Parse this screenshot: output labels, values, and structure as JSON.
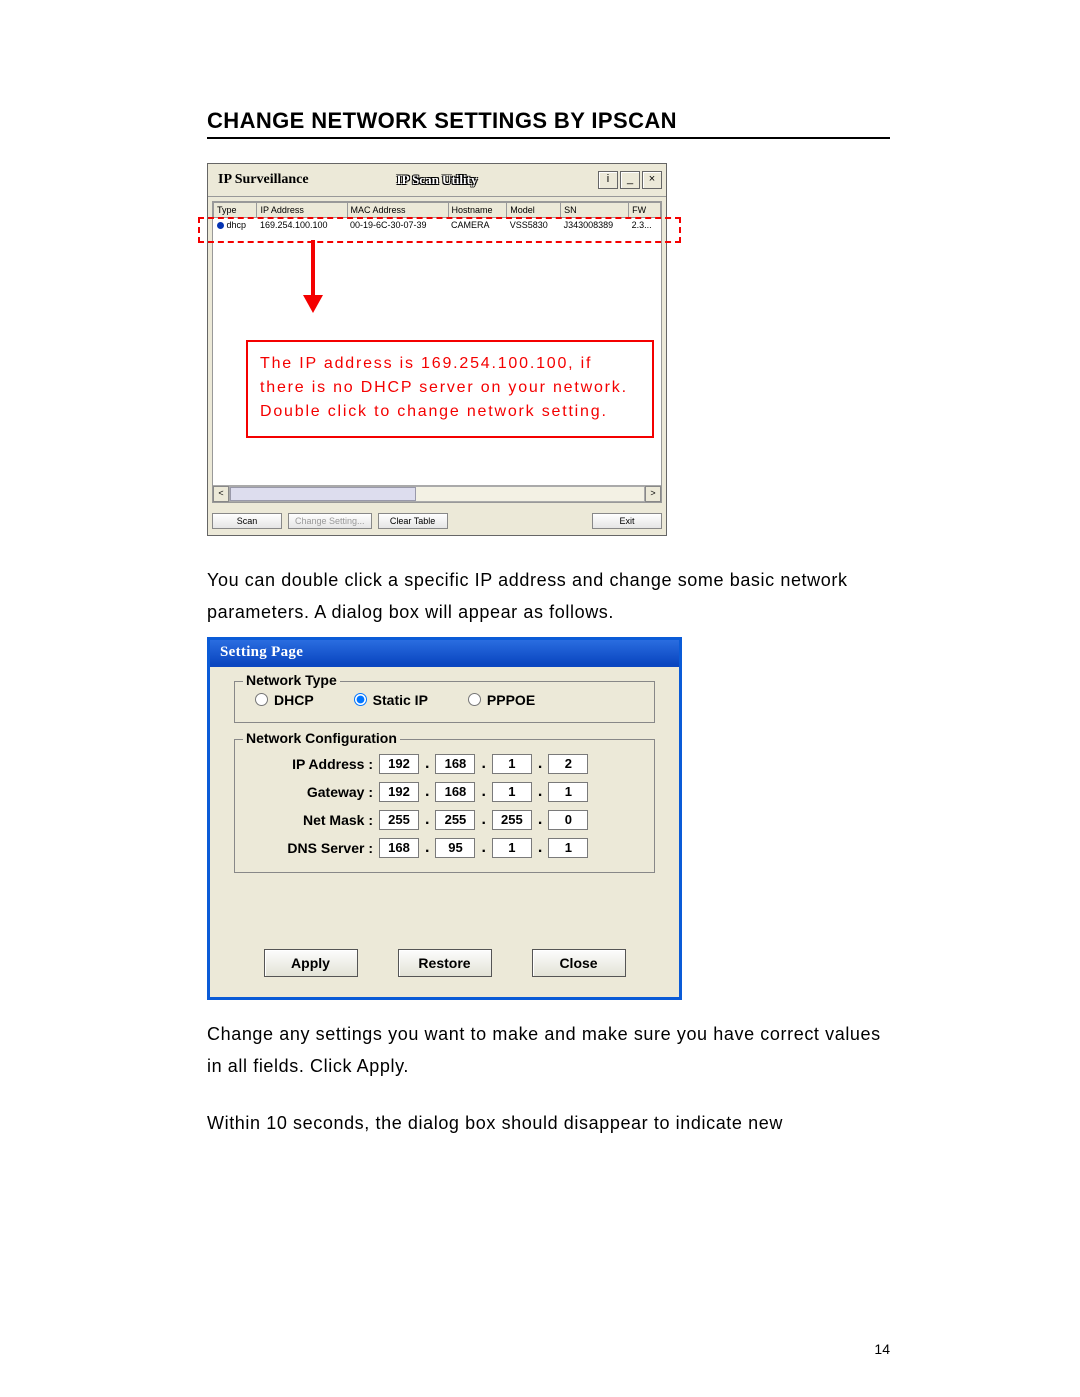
{
  "title": "CHANGE NETWORK SETTINGS BY IPSCAN",
  "page_number": "14",
  "ipscan": {
    "title_left": "IP Surveillance",
    "title_mid": "IP Scan Utility",
    "win_info": "i",
    "win_min": "_",
    "win_close": "×",
    "columns": [
      "Type",
      "IP Address",
      "MAC Address",
      "Hostname",
      "Model",
      "SN",
      "FW"
    ],
    "row": {
      "type": "dhcp",
      "ip": "169.254.100.100",
      "mac": "00-19-6C-30-07-39",
      "host": "CAMERA",
      "model": "VSS5830",
      "sn": "J343008389",
      "fw": "2.3..."
    },
    "buttons": {
      "scan": "Scan",
      "change": "Change Setting...",
      "clear": "Clear Table",
      "exit": "Exit"
    }
  },
  "callout": {
    "line1": "The IP address is 169.254.100.100, if there is no DHCP server on your network.",
    "line2": "Double click to change network setting."
  },
  "para1": "You can double click a specific IP address and change some basic network parameters. A dialog box will appear as follows.",
  "dialog": {
    "title": "Setting Page",
    "network_type_legend": "Network Type",
    "radios": {
      "dhcp": "DHCP",
      "static": "Static IP",
      "pppoe": "PPPOE"
    },
    "selected_radio": "static",
    "config_legend": "Network Configuration",
    "labels": {
      "ip": "IP Address :",
      "gw": "Gateway :",
      "mask": "Net Mask :",
      "dns": "DNS Server :"
    },
    "values": {
      "ip": [
        "192",
        "168",
        "1",
        "2"
      ],
      "gw": [
        "192",
        "168",
        "1",
        "1"
      ],
      "mask": [
        "255",
        "255",
        "255",
        "0"
      ],
      "dns": [
        "168",
        "95",
        "1",
        "1"
      ]
    },
    "buttons": {
      "apply": "Apply",
      "restore": "Restore",
      "close": "Close"
    }
  },
  "para2": "Change any settings you want to make and make sure you have correct values in all fields. Click Apply.",
  "para3": "Within 10 seconds, the dialog box should disappear to indicate new"
}
